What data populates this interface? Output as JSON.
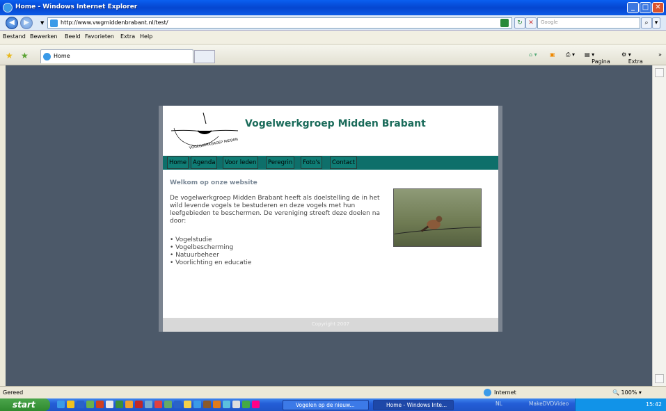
{
  "window": {
    "title": "Home - Windows Internet Explorer"
  },
  "address": {
    "url": "http://www.vwgmiddenbrabant.nl/test/",
    "search_placeholder": "Google"
  },
  "menu": [
    "Bestand",
    "Bewerken",
    "Beeld",
    "Favorieten",
    "Extra",
    "Help"
  ],
  "tab": {
    "label": "Home"
  },
  "toolbar": {
    "page_label": "Pagina",
    "extra_label": "Extra"
  },
  "site": {
    "title": "Vogelwerkgroep Midden Brabant",
    "logo_text": "VOGELWERKGROEP MIDDEN BRABANT",
    "nav": [
      "Home",
      "Agenda",
      "Voor leden",
      "Peregrin",
      "Foto's",
      "Contact"
    ],
    "welcome": "Welkom op onze website",
    "intro": "De vogelwerkgroep Midden Brabant heeft als doelstelling de in het wild levende vogels te bestuderen en deze vogels met hun leefgebieden te beschermen. De vereniging streeft deze doelen na door:",
    "list": [
      "Vogelstudie",
      "Vogelbescherming",
      "Natuurbeheer",
      "Voorlichting en educatie"
    ],
    "footer": "Copyright 2007"
  },
  "status": {
    "text": "Gereed",
    "zone": "Internet",
    "zoom": "100%"
  },
  "taskbar": {
    "start_label": "start",
    "items": [
      "Vogelen op de nieuw...",
      "Home - Windows Inte..."
    ],
    "tray_lang": "NL",
    "tray_app": "MakeDVDVideo",
    "clock": "15:42"
  },
  "colors": {
    "site_nav": "#0e6f6a",
    "site_title": "#1a6b5a",
    "background": "#4c5969"
  }
}
